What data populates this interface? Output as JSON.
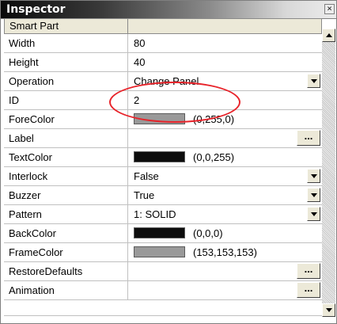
{
  "window": {
    "title": "Inspector",
    "close_glyph": "×"
  },
  "header": {
    "column1": "Smart Part",
    "column2": ""
  },
  "properties": [
    {
      "name": "Width",
      "value": "80",
      "type": "text"
    },
    {
      "name": "Height",
      "value": "40",
      "type": "text"
    },
    {
      "name": "Operation",
      "value": "Change Panel",
      "type": "dropdown"
    },
    {
      "name": "ID",
      "value": "2",
      "type": "text"
    },
    {
      "name": "ForeColor",
      "value": "(0,255,0)",
      "type": "color",
      "swatch": "#999999"
    },
    {
      "name": "Label",
      "value": "",
      "type": "ellipsis",
      "button_label": "..."
    },
    {
      "name": "TextColor",
      "value": "(0,0,255)",
      "type": "color",
      "swatch": "#0d0d0d"
    },
    {
      "name": "Interlock",
      "value": "False",
      "type": "dropdown"
    },
    {
      "name": "Buzzer",
      "value": "True",
      "type": "dropdown"
    },
    {
      "name": "Pattern",
      "value": "1: SOLID",
      "type": "dropdown"
    },
    {
      "name": "BackColor",
      "value": "(0,0,0)",
      "type": "color",
      "swatch": "#0d0d0d"
    },
    {
      "name": "FrameColor",
      "value": "(153,153,153)",
      "type": "color",
      "swatch": "#999999"
    },
    {
      "name": "RestoreDefaults",
      "value": "",
      "type": "ellipsis",
      "button_label": "..."
    },
    {
      "name": "Animation",
      "value": "",
      "type": "ellipsis",
      "button_label": "..."
    }
  ],
  "icons": {
    "close": "close-icon",
    "dropdown": "chevron-down-icon",
    "scroll_up": "scroll-up-icon",
    "scroll_down": "scroll-down-icon"
  },
  "colors": {
    "highlight_ellipse": "#e8232a",
    "button_face": "#ece9d8"
  }
}
